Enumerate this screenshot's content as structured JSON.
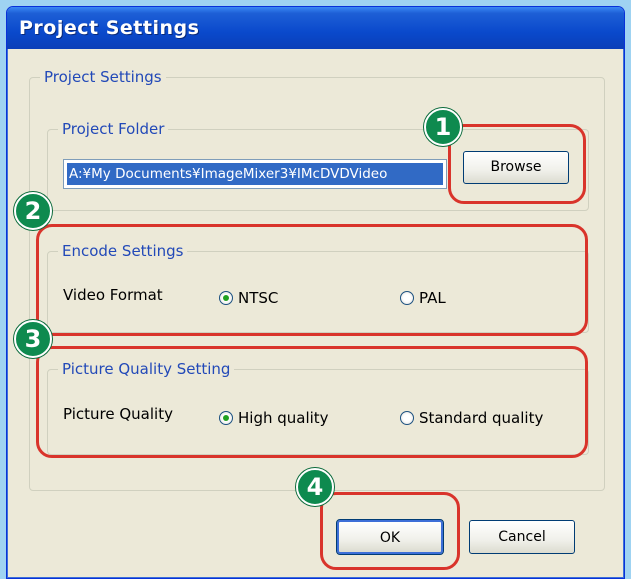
{
  "dialog": {
    "title": "Project Settings",
    "group_project": {
      "label": "Project Settings"
    },
    "group_folder": {
      "label": "Project Folder",
      "path_value": "A:¥My Documents¥ImageMixer3¥IMcDVDVideo",
      "browse_label": "Browse"
    },
    "group_encode": {
      "label": "Encode Settings",
      "field_label": "Video Format",
      "options": [
        {
          "label": "NTSC",
          "selected": true
        },
        {
          "label": "PAL",
          "selected": false
        }
      ]
    },
    "group_quality": {
      "label": "Picture Quality Setting",
      "field_label": "Picture Quality",
      "options": [
        {
          "label": "High quality",
          "selected": true
        },
        {
          "label": "Standard quality",
          "selected": false
        }
      ]
    },
    "ok_label": "OK",
    "cancel_label": "Cancel"
  },
  "callouts": {
    "badge_1": "1",
    "badge_2": "2",
    "badge_3": "3",
    "badge_4": "4",
    "color": "#d9342b",
    "badge_color": "#0e8a4f"
  },
  "colors": {
    "titlebar": "#0a49cc",
    "dialog_bg": "#ece9d8",
    "group_label": "#2249b8",
    "selection": "#316ac5"
  }
}
